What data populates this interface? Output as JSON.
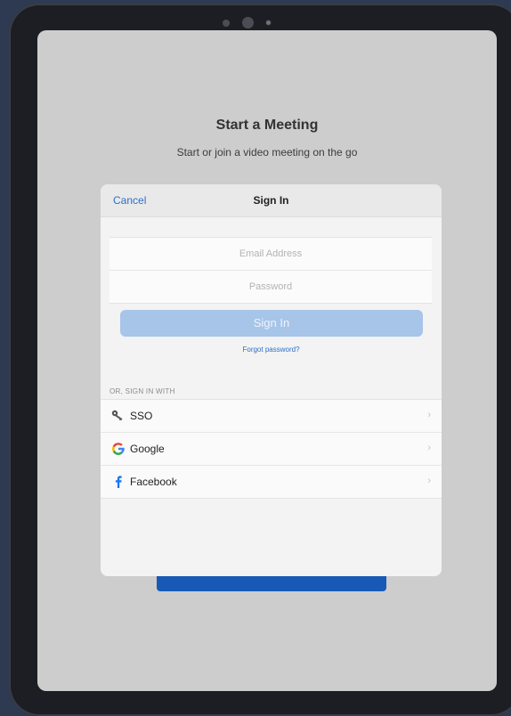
{
  "background_screen": {
    "title": "Start a Meeting",
    "subtitle": "Start or join a video meeting on the go"
  },
  "sheet": {
    "cancel_label": "Cancel",
    "title": "Sign In",
    "email_placeholder": "Email Address",
    "password_placeholder": "Password",
    "signin_label": "Sign In",
    "forgot_label": "Forgot password?",
    "or_label": "OR, SIGN IN WITH",
    "providers": [
      {
        "label": "SSO",
        "icon": "key-icon"
      },
      {
        "label": "Google",
        "icon": "google-icon"
      },
      {
        "label": "Facebook",
        "icon": "facebook-icon"
      }
    ]
  },
  "colors": {
    "accent": "#2d6fc8",
    "signin_disabled": "#a7c4e9",
    "google_blue": "#4285f4",
    "google_red": "#ea4335",
    "google_yellow": "#fbbc05",
    "google_green": "#34a853",
    "facebook_blue": "#1877f2"
  }
}
